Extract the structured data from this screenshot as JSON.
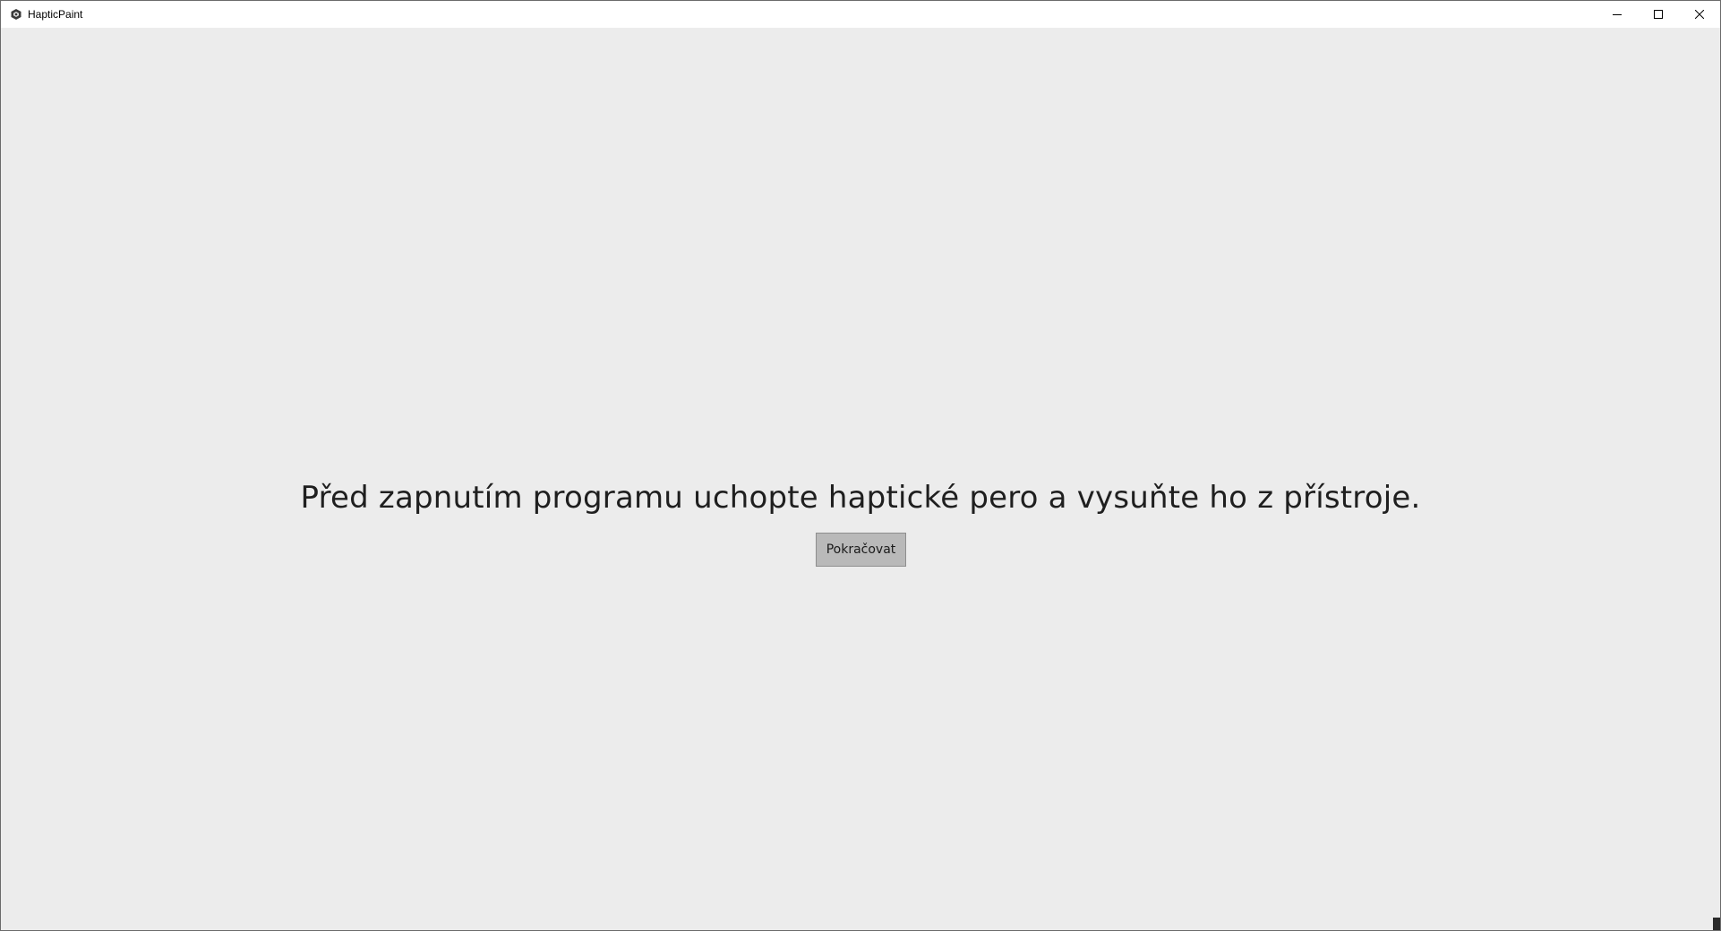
{
  "window": {
    "title": "HapticPaint",
    "app_icon": "hexagon-app-icon",
    "controls": {
      "minimize_icon": "minimize-icon",
      "maximize_icon": "maximize-icon",
      "close_icon": "close-icon"
    }
  },
  "main": {
    "message": "Před zapnutím programu uchopte haptické pero a vysuňte ho z přístroje.",
    "continue_label": "Pokračovat"
  },
  "colors": {
    "background": "#ececec",
    "titlebar": "#ffffff",
    "button": "#b9b9b9",
    "text": "#1f1f1f"
  }
}
